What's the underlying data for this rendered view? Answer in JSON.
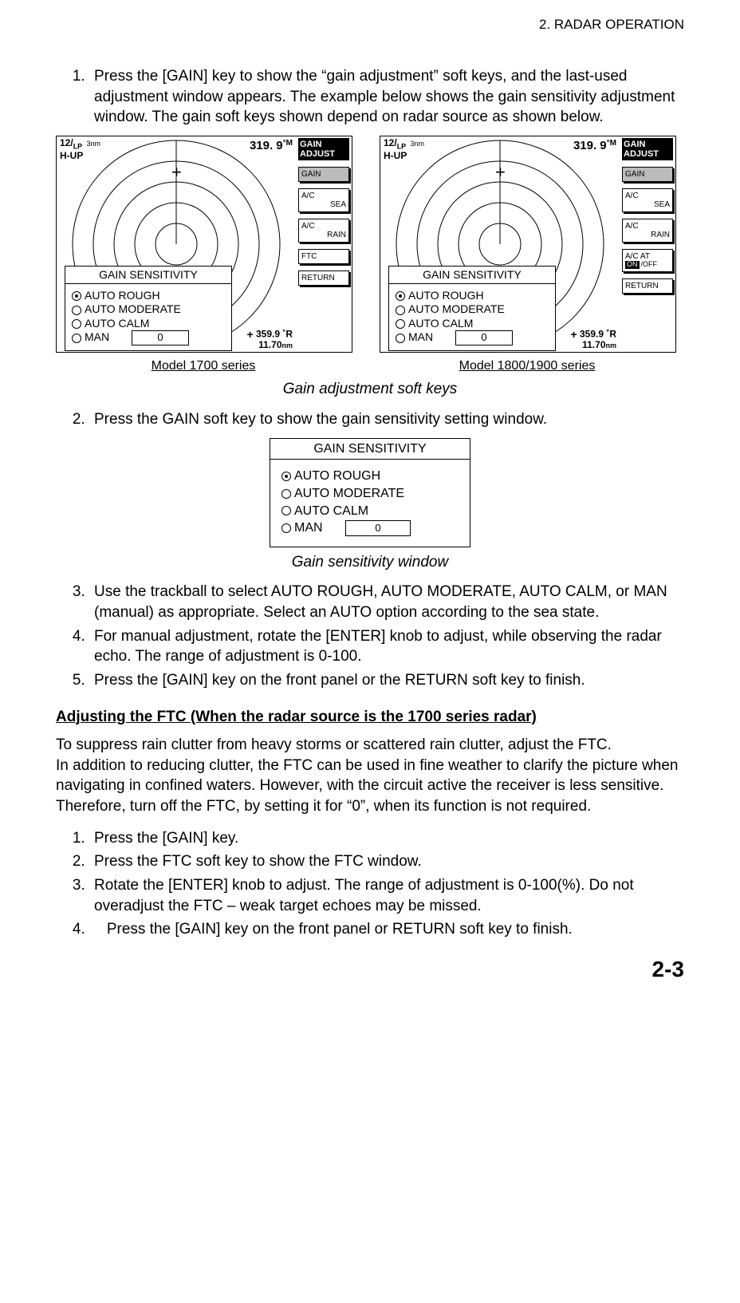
{
  "header": {
    "running": "2. RADAR OPERATION"
  },
  "steps_top": {
    "s1": "Press the [GAIN] key to show the “gain adjustment” soft keys, and the last-used adjustment window appears. The example below shows the gain sensitivity adjustment window. The gain soft keys shown depend on radar source as shown below."
  },
  "radar": {
    "top_left_line1": "12/",
    "top_left_lp": "LP",
    "top_left_nm": "3nm",
    "top_left_line2": "H-UP",
    "heading": "319. 9",
    "heading_deg": "°",
    "heading_m": "M",
    "bottom_plus": "+",
    "bottom_l1": "359.9 ˚R",
    "bottom_l2": "11.70",
    "bottom_nm": "nm",
    "softkeys": {
      "title_l1": "GAIN",
      "title_l2": "ADJUST",
      "gain": "GAIN",
      "ac": "A/C",
      "sea": "SEA",
      "rain": "RAIN",
      "ftc": "FTC",
      "acat": "A/C AT",
      "on": "ON",
      "off": "/OFF",
      "return": "RETURN"
    },
    "gainwin": {
      "title": "GAIN SENSITIVITY",
      "opt1": "AUTO ROUGH",
      "opt2": "AUTO MODERATE",
      "opt3": "AUTO CALM",
      "opt4": "MAN",
      "man_val": "0"
    },
    "model_a": "Model 1700 series",
    "model_b": "Model 1800/1900 series"
  },
  "captions": {
    "fig1": "Gain adjustment soft keys",
    "fig2": "Gain sensitivity window"
  },
  "steps_mid": {
    "s2": "Press the GAIN soft key to show the gain sensitivity setting window.",
    "s3": "Use the trackball to select AUTO ROUGH, AUTO MODERATE, AUTO CALM, or MAN (manual) as appropriate. Select an AUTO option according to the sea state.",
    "s4": "For manual adjustment, rotate the [ENTER] knob to adjust, while observing the radar echo. The range of adjustment is 0-100.",
    "s5": "Press the [GAIN] key on the front panel or the RETURN soft key to finish."
  },
  "ftc": {
    "subhead": "Adjusting the FTC (When the radar source is the 1700 series radar)",
    "para1": "To suppress rain clutter from heavy storms or scattered rain clutter, adjust the FTC.",
    "para2": "In addition to reducing clutter, the FTC can be used in fine weather to clarify the picture when navigating in confined waters. However, with the circuit active the receiver is less sensitive. Therefore, turn off the FTC, by setting it for “0”, when its function is not required.",
    "s1": "Press the [GAIN] key.",
    "s2": "Press the FTC soft key to show the FTC window.",
    "s3": "Rotate the [ENTER] knob to adjust. The range of adjustment is 0-100(%). Do not overadjust the FTC – weak target echoes may be missed.",
    "s4": "   Press the [GAIN] key on the front panel or RETURN soft key to finish."
  },
  "pagenum": "2-3"
}
